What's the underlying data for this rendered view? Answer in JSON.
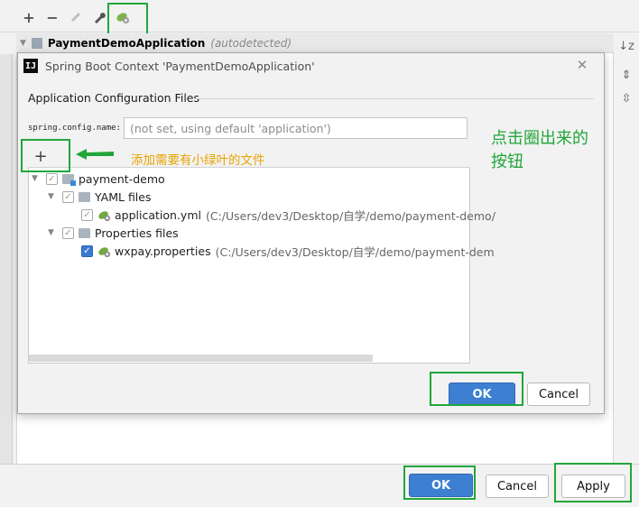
{
  "settings": {
    "toolbar": {
      "add": "+",
      "remove": "−",
      "edit": "✎",
      "wrench": "🔧"
    },
    "tree_header": {
      "app_name": "PaymentDemoApplication",
      "tag": "(autodetected)"
    },
    "footer": {
      "ok": "OK",
      "cancel": "Cancel",
      "apply": "Apply"
    }
  },
  "dialog": {
    "title": "Spring Boot Context 'PaymentDemoApplication'",
    "logo": "IJ",
    "section_title": "Application Configuration Files",
    "config_name_label": "spring.config.name:",
    "config_name_placeholder": "(not set, using default 'application')",
    "add_label": "+",
    "tree": {
      "root": "payment-demo",
      "yaml_folder": "YAML files",
      "yaml_file": "application.yml",
      "yaml_path": "(C:/Users/dev3/Desktop/自学/demo/payment-demo/",
      "props_folder": "Properties files",
      "props_file": "wxpay.properties",
      "props_path": "(C:/Users/dev3/Desktop/自学/demo/payment-dem"
    },
    "ok": "OK",
    "cancel": "Cancel"
  },
  "annotations": {
    "add_hint": "添加需要有小绿叶的文件",
    "click_hint_line1": "点击圈出来的",
    "click_hint_line2": "按钮"
  },
  "colors": {
    "annotation_green": "#21a63a",
    "annotation_yellow": "#e8a400",
    "primary_button": "#3d7fd0"
  }
}
